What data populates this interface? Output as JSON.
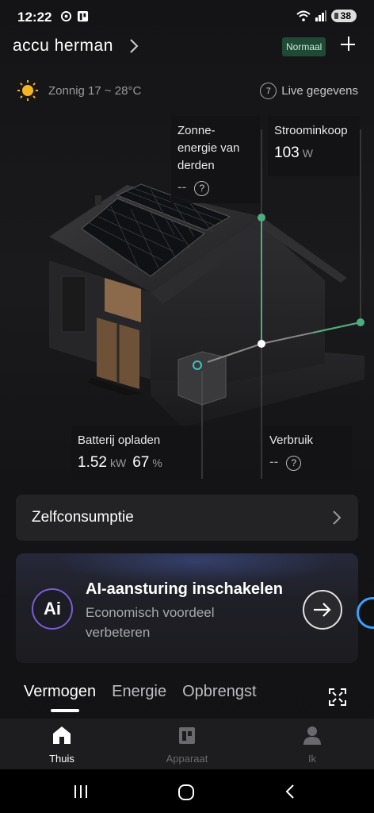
{
  "status": {
    "time": "12:22",
    "battery": "38"
  },
  "header": {
    "title": "accu herman",
    "mode_badge": "Normaal"
  },
  "weather": {
    "text": "Zonnig 17 ~ 28°C",
    "live_badge": "7",
    "live_label": "Live gegevens"
  },
  "flows": {
    "third_party_solar": {
      "label": "Zonne-energie van derden",
      "label_lines": [
        "Zonne-",
        "energie van",
        "derden"
      ],
      "value": "--"
    },
    "grid_purchase": {
      "label": "Stroominkoop",
      "value": "103",
      "unit": "W"
    },
    "battery": {
      "label": "Batterij opladen",
      "power": "1.52",
      "power_unit": "kW",
      "soc": "67",
      "soc_unit": "%"
    },
    "consumption": {
      "label": "Verbruik",
      "value": "--"
    }
  },
  "card_selfconsumption": {
    "label": "Zelfconsumptie"
  },
  "card_ai": {
    "badge": "Ai",
    "title": "AI-aansturing inschakelen",
    "subtitle": "Economisch voordeel verbeteren"
  },
  "tabs": [
    {
      "label": "Vermogen",
      "active": true
    },
    {
      "label": "Energie",
      "active": false
    },
    {
      "label": "Opbrengst",
      "active": false
    }
  ],
  "nav": [
    {
      "label": "Thuis",
      "icon": "home-icon",
      "active": true
    },
    {
      "label": "Apparaat",
      "icon": "device-icon",
      "active": false
    },
    {
      "label": "Ik",
      "icon": "profile-icon",
      "active": false
    }
  ],
  "colors": {
    "accent_green": "#4caf7d",
    "badge_bg": "#1f4a35",
    "sun": "#f5b522",
    "ai_ring": "#7c5cd6"
  }
}
